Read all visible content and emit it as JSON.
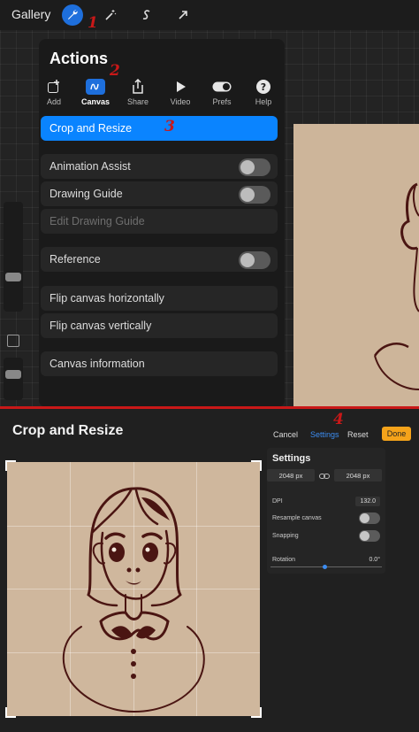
{
  "toolbar": {
    "gallery_label": "Gallery"
  },
  "markers": {
    "m1": "1",
    "m2": "2",
    "m3": "3",
    "m4": "4"
  },
  "actions": {
    "title": "Actions",
    "tabs": [
      {
        "label": "Add",
        "icon": "add-photo-icon"
      },
      {
        "label": "Canvas",
        "icon": "canvas-icon",
        "active": true
      },
      {
        "label": "Share",
        "icon": "share-icon"
      },
      {
        "label": "Video",
        "icon": "play-icon"
      },
      {
        "label": "Prefs",
        "icon": "toggle-icon"
      },
      {
        "label": "Help",
        "icon": "help-icon"
      }
    ],
    "items": {
      "crop": "Crop and Resize",
      "animation": "Animation Assist",
      "drawing_guide": "Drawing Guide",
      "edit_guide": "Edit Drawing Guide",
      "reference": "Reference",
      "flip_h": "Flip canvas horizontally",
      "flip_v": "Flip canvas vertically",
      "info": "Canvas information"
    },
    "toggles": {
      "animation": false,
      "drawing_guide": false,
      "reference": false
    }
  },
  "crop": {
    "title": "Crop and Resize",
    "cancel": "Cancel",
    "settings_tab": "Settings",
    "reset": "Reset",
    "done": "Done",
    "settings": {
      "title": "Settings",
      "width": "2048 px",
      "height": "2048 px",
      "dpi_label": "DPI",
      "dpi_value": "132.0",
      "resample_label": "Resample canvas",
      "resample": false,
      "snapping_label": "Snapping",
      "snapping": false,
      "rotation_label": "Rotation",
      "rotation_value": "0.0°"
    }
  },
  "colors": {
    "accent": "#0a84ff",
    "marker": "#c91818",
    "done": "#f5a31a",
    "ink": "#4a1512",
    "paper": "#cfb79d"
  }
}
